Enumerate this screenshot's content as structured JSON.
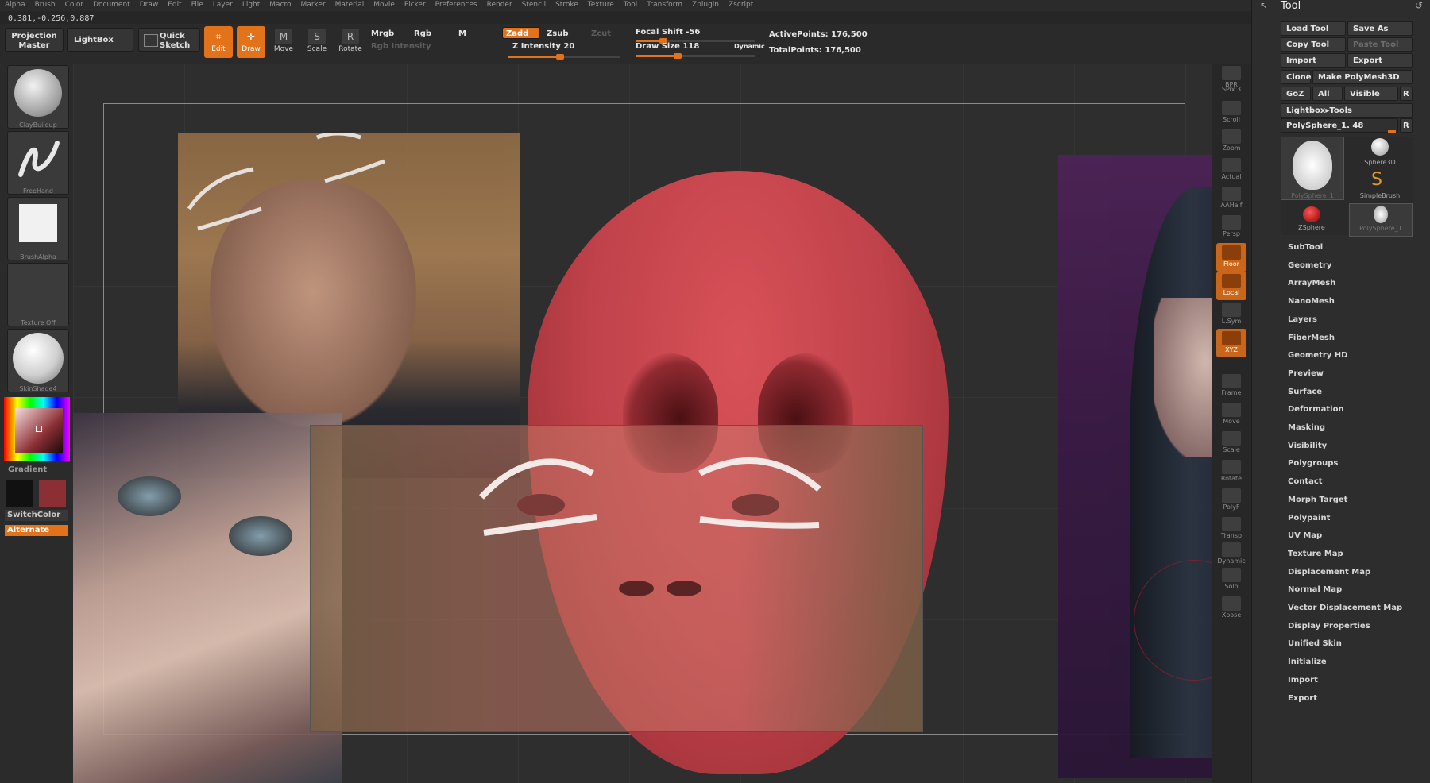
{
  "menu": [
    "Alpha",
    "Brush",
    "Color",
    "Document",
    "Draw",
    "Edit",
    "File",
    "Layer",
    "Light",
    "Macro",
    "Marker",
    "Material",
    "Movie",
    "Picker",
    "Preferences",
    "Render",
    "Stencil",
    "Stroke",
    "Texture",
    "Tool",
    "Transform",
    "Zplugin",
    "Zscript"
  ],
  "coords": "0.381,-0.256,0.887",
  "toolbar": {
    "projection_master": "Projection Master",
    "lightbox": "LightBox",
    "quick_sketch": "Quick Sketch",
    "edit": "Edit",
    "draw": "Draw",
    "move": "Move",
    "scale": "Scale",
    "rotate": "Rotate",
    "mrgb": "Mrgb",
    "rgb": "Rgb",
    "m": "M",
    "rgb_intensity": "Rgb Intensity",
    "zadd": "Zadd",
    "zsub": "Zsub",
    "zcut": "Zcut",
    "z_intensity": "Z Intensity 20",
    "focal_shift": "Focal Shift -56",
    "draw_size": "Draw Size 118",
    "dynamic": "Dynamic",
    "active_points": "ActivePoints: 176,500",
    "total_points": "TotalPoints: 176,500"
  },
  "left_shelf": {
    "brush": "ClayBuildup",
    "stroke": "FreeHand",
    "alpha": "BrushAlpha",
    "texture": "Texture Off",
    "material": "SkinShade4",
    "gradient": "Gradient",
    "switch_color": "SwitchColor",
    "alternate": "Alternate",
    "main_color": "#111111",
    "secondary_color": "#8b2f35"
  },
  "right_shelf": [
    {
      "label": "BPR",
      "icon": "sphere-icon"
    },
    {
      "label": "SPix 3",
      "icon": ""
    },
    {
      "label": "Scroll",
      "icon": "hand-icon"
    },
    {
      "label": "Zoom",
      "icon": "magnifier-icon"
    },
    {
      "label": "Actual",
      "icon": "magnifier-icon"
    },
    {
      "label": "AAHalf",
      "icon": "magnifier-icon"
    },
    {
      "label": "Persp",
      "icon": "grid-icon"
    },
    {
      "label": "Floor",
      "icon": "floor-icon"
    },
    {
      "label": "Local",
      "icon": "local-icon"
    },
    {
      "label": "L.Sym",
      "icon": "symmetry-icon"
    },
    {
      "label": "XYZ",
      "icon": "axis-icon"
    },
    {
      "label": "Frame",
      "icon": "frame-icon"
    },
    {
      "label": "Move",
      "icon": "hand-icon"
    },
    {
      "label": "Scale",
      "icon": "scale-icon"
    },
    {
      "label": "Rotate",
      "icon": "rotate-icon"
    },
    {
      "label": "PolyF",
      "icon": "polyframe-icon"
    },
    {
      "label": "Transp",
      "icon": "transparency-icon"
    },
    {
      "label": "Dynamic",
      "icon": "dynamic-icon"
    },
    {
      "label": "Solo",
      "icon": "solo-icon"
    },
    {
      "label": "Xpose",
      "icon": "xpose-icon"
    }
  ],
  "palette": {
    "title": "Tool",
    "load_tool": "Load Tool",
    "save_as": "Save As",
    "copy_tool": "Copy Tool",
    "paste_tool": "Paste Tool",
    "import": "Import",
    "export": "Export",
    "clone": "Clone",
    "make_polymesh": "Make PolyMesh3D",
    "goz": "GoZ",
    "all": "All",
    "visible": "Visible",
    "r": "R",
    "lightbox_tools": "Lightbox▸Tools",
    "current_tool": "PolySphere_1. 48",
    "tools": [
      "PolySphere_1",
      "Sphere3D",
      "SimpleBrush",
      "ZSphere",
      "PolySphere_1"
    ],
    "subpalettes": [
      "SubTool",
      "Geometry",
      "ArrayMesh",
      "NanoMesh",
      "Layers",
      "FiberMesh",
      "Geometry HD",
      "Preview",
      "Surface",
      "Deformation",
      "Masking",
      "Visibility",
      "Polygroups",
      "Contact",
      "Morph Target",
      "Polypaint",
      "UV Map",
      "Texture Map",
      "Displacement Map",
      "Normal Map",
      "Vector Displacement Map",
      "Display Properties",
      "Unified Skin",
      "Initialize",
      "Import",
      "Export"
    ]
  },
  "colors": {
    "accent": "#e3731a",
    "mesh": "#c8484c",
    "purple": "#4a1f55"
  }
}
